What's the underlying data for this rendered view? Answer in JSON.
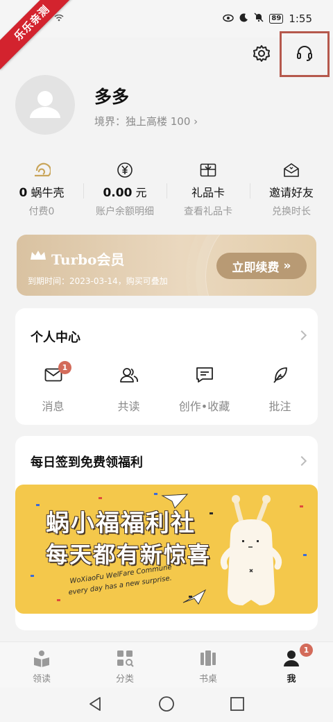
{
  "status_bar": {
    "time": "1:55",
    "battery": "89"
  },
  "watermark": "乐乐亲测",
  "profile": {
    "name": "多多",
    "realm": "境界：独上高楼 100 ›"
  },
  "stats": [
    {
      "value": "0",
      "unit": "蜗牛壳",
      "sub": "付费0",
      "icon": "snail-shell-icon"
    },
    {
      "value": "0.00",
      "unit": "元",
      "sub": "账户余额明细",
      "icon": "yuan-icon"
    },
    {
      "value": "",
      "unit": "礼品卡",
      "sub": "查看礼品卡",
      "icon": "gift-card-icon"
    },
    {
      "value": "",
      "unit": "邀请好友",
      "sub": "兑换时长",
      "icon": "invite-envelope-icon"
    }
  ],
  "turbo": {
    "title": "Turbo会员",
    "expire": "到期时间：2023-03-14，购买可叠加",
    "renew": "立即续费",
    "renew_arrow": "»"
  },
  "personal_center": {
    "title": "个人中心",
    "items": [
      {
        "label": "消息",
        "icon": "mail-icon",
        "badge": "1"
      },
      {
        "label": "共读",
        "icon": "users-icon"
      },
      {
        "label": "创作•收藏",
        "icon": "comment-icon"
      },
      {
        "label": "批注",
        "icon": "feather-icon"
      }
    ]
  },
  "checkin": {
    "title": "每日签到免费领福利",
    "banner_line1": "蜗小福福利社",
    "banner_line2": "每天都有新惊喜",
    "banner_sub1": "WoXiaoFu WelFare Commune",
    "banner_sub2": "every day has a new surprise."
  },
  "bottom_nav": [
    {
      "label": "领读",
      "icon": "read-icon"
    },
    {
      "label": "分类",
      "icon": "category-icon"
    },
    {
      "label": "书桌",
      "icon": "bookshelf-icon"
    },
    {
      "label": "我",
      "icon": "user-icon",
      "badge": "1",
      "active": true
    }
  ],
  "colors": {
    "accent": "#b89a74",
    "badge": "#d36b5a",
    "banner": "#f4c84b",
    "highlight_box": "#b5584c"
  }
}
